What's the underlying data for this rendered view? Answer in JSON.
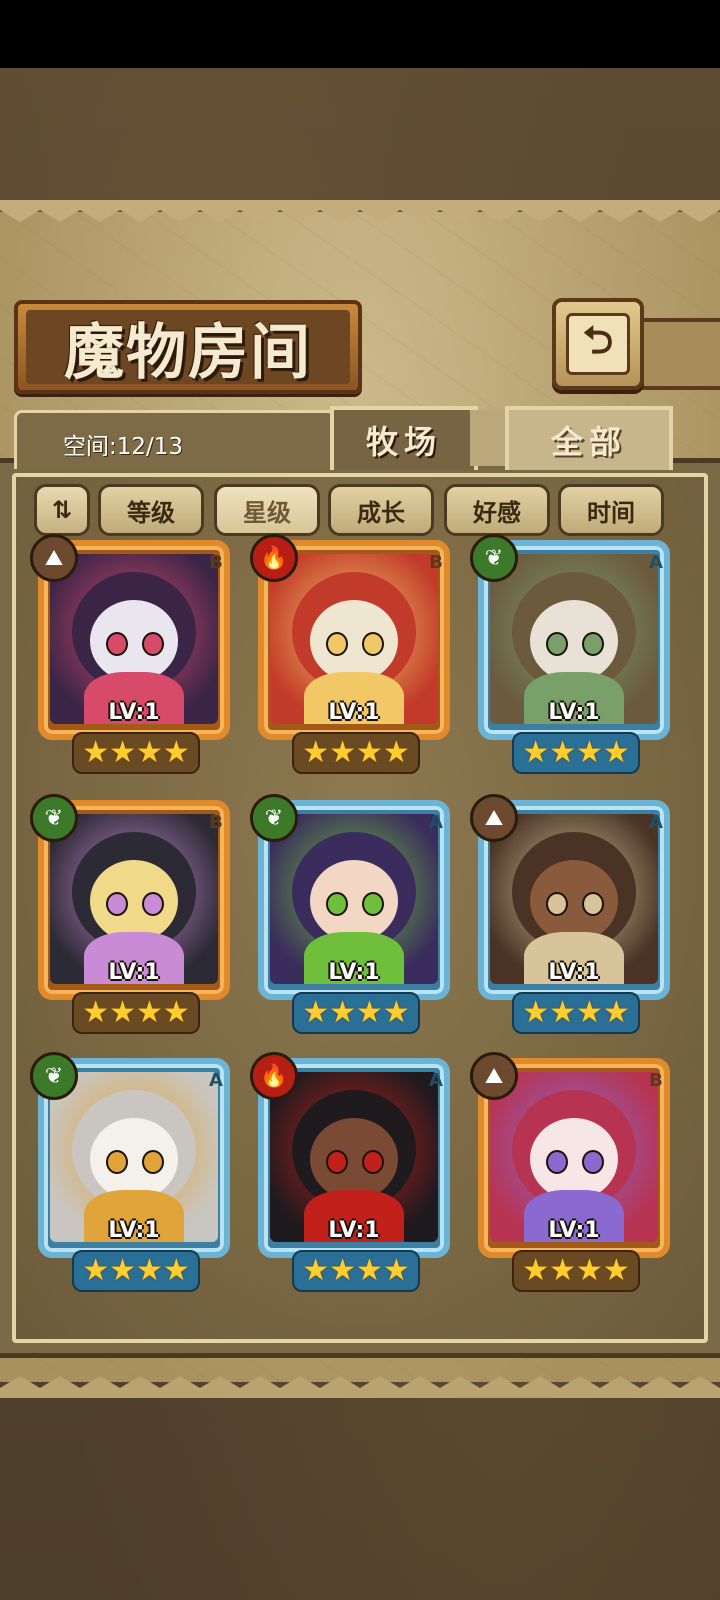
{
  "header": {
    "title": "魔物房间",
    "back_icon": "return-arrow-icon",
    "back_glyph": "⮌"
  },
  "storage": {
    "label": "空间:12/13"
  },
  "tabs": [
    {
      "label": "牧场",
      "active": true
    },
    {
      "label": "全部",
      "active": false
    }
  ],
  "sort": {
    "toggle_label": "⇅",
    "options": [
      {
        "label": "等级",
        "selected": false
      },
      {
        "label": "星级",
        "selected": true
      },
      {
        "label": "成长",
        "selected": false
      },
      {
        "label": "好感",
        "selected": false
      },
      {
        "label": "时间",
        "selected": false
      }
    ]
  },
  "monsters": [
    {
      "grade": "B",
      "element": "earth",
      "level": "LV:1",
      "stars": 4,
      "palette": [
        "#3b2547",
        "#e9e6f0",
        "#d84a6a"
      ]
    },
    {
      "grade": "B",
      "element": "fire",
      "level": "LV:1",
      "stars": 4,
      "palette": [
        "#c23a2a",
        "#efe6d2",
        "#f2c866"
      ]
    },
    {
      "grade": "A",
      "element": "leaf",
      "level": "LV:1",
      "stars": 4,
      "palette": [
        "#6b5a3c",
        "#e8e2d6",
        "#7aa06a"
      ]
    },
    {
      "grade": "B",
      "element": "leaf",
      "level": "LV:1",
      "stars": 4,
      "palette": [
        "#2c2a34",
        "#f1d98a",
        "#c98ad6"
      ]
    },
    {
      "grade": "A",
      "element": "leaf",
      "level": "LV:1",
      "stars": 4,
      "palette": [
        "#3a2c5c",
        "#f2d7c4",
        "#6fbf3c"
      ]
    },
    {
      "grade": "A",
      "element": "earth",
      "level": "LV:1",
      "stars": 4,
      "palette": [
        "#4a3224",
        "#8a5a3c",
        "#d8c49a"
      ]
    },
    {
      "grade": "A",
      "element": "leaf",
      "level": "LV:1",
      "stars": 4,
      "palette": [
        "#c9c6c2",
        "#f4f0ea",
        "#e0a43a"
      ]
    },
    {
      "grade": "A",
      "element": "fire",
      "level": "LV:1",
      "stars": 4,
      "palette": [
        "#1f1a1e",
        "#7a4a34",
        "#c2201a"
      ]
    },
    {
      "grade": "B",
      "element": "earth",
      "level": "LV:1",
      "stars": 4,
      "palette": [
        "#b73352",
        "#f6e6e6",
        "#8a6ad0"
      ]
    }
  ],
  "element_glyphs": {
    "earth": "⛰",
    "fire": "🔥",
    "leaf": "❦"
  },
  "star_glyph": "★"
}
